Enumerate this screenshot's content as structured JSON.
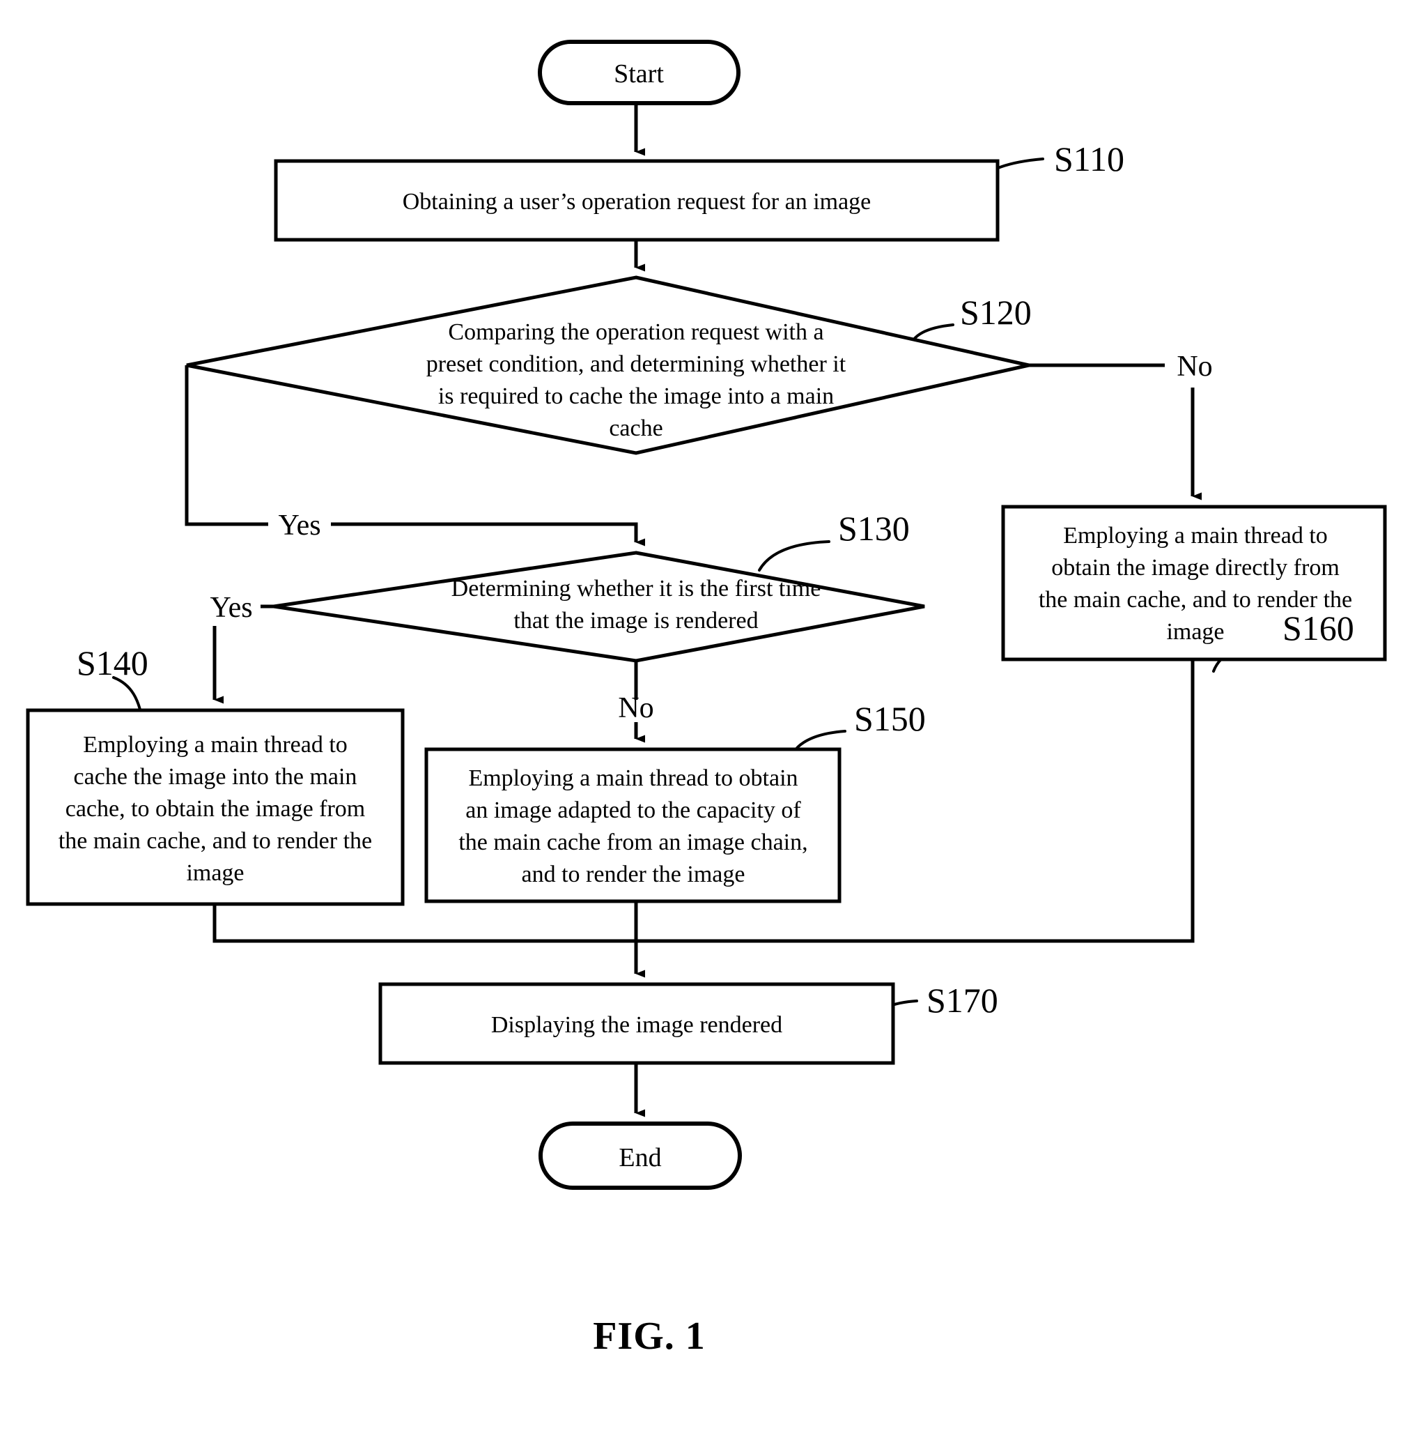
{
  "figure": {
    "caption": "FIG. 1",
    "type": "flowchart"
  },
  "nodes": {
    "start": {
      "label": "Start",
      "shape": "terminator"
    },
    "end": {
      "label": "End",
      "shape": "terminator"
    },
    "s110": {
      "step": "S110",
      "shape": "process",
      "lines": [
        "Obtaining a user’s operation request for an image"
      ]
    },
    "s120": {
      "step": "S120",
      "shape": "decision",
      "lines": [
        "Comparing the operation request with a",
        "preset condition, and determining whether it",
        "is required to cache the image into a main",
        "cache"
      ]
    },
    "s130": {
      "step": "S130",
      "shape": "decision",
      "lines": [
        "Determining whether it is the first time",
        "that the image is rendered"
      ]
    },
    "s140": {
      "step": "S140",
      "shape": "process",
      "lines": [
        "Employing a main thread to",
        "cache the image into the main",
        "cache, to obtain the image from",
        "the main cache, and to render the",
        "image"
      ]
    },
    "s150": {
      "step": "S150",
      "shape": "process",
      "lines": [
        "Employing a main thread to obtain",
        "an image adapted to the capacity of",
        "the main cache from an image chain,",
        "and to render the image"
      ]
    },
    "s160": {
      "step": "S160",
      "shape": "process",
      "lines": [
        "Employing a main thread to",
        "obtain the image directly from",
        "the main cache, and to render the",
        "image"
      ]
    },
    "s170": {
      "step": "S170",
      "shape": "process",
      "lines": [
        "Displaying the image rendered"
      ]
    }
  },
  "branch_labels": {
    "s120_yes": "Yes",
    "s120_no": "No",
    "s130_yes": "Yes",
    "s130_no": "No"
  },
  "colors": {
    "stroke": "#000000",
    "fill": "#ffffff",
    "background": "#ffffff"
  }
}
